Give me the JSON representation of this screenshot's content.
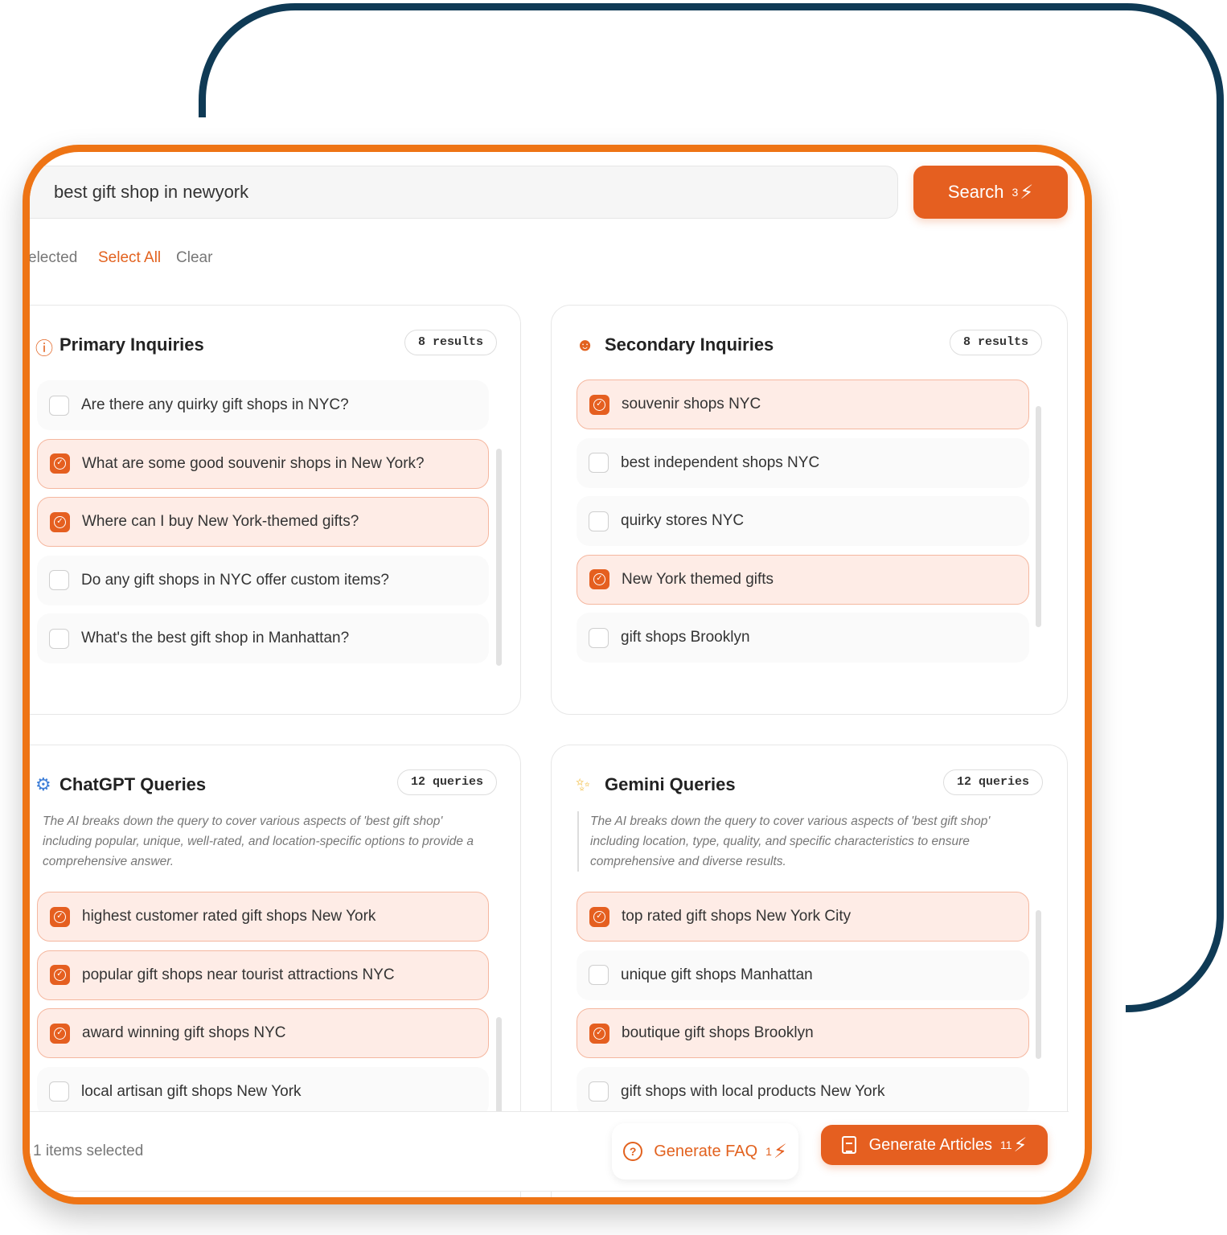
{
  "search": {
    "value": "best gift shop in newyork",
    "button_label": "Search",
    "button_cost": "3"
  },
  "selection": {
    "count_label": "elected",
    "select_all": "Select All",
    "clear": "Clear"
  },
  "primary": {
    "title": "Primary Inquiries",
    "badge": "8 results",
    "items": [
      {
        "label": "Are there any quirky gift shops in NYC?",
        "checked": false
      },
      {
        "label": "What are some good souvenir shops in New York?",
        "checked": true
      },
      {
        "label": "Where can I buy New York-themed gifts?",
        "checked": true
      },
      {
        "label": "Do any gift shops in NYC offer custom items?",
        "checked": false
      },
      {
        "label": "What's the best gift shop in Manhattan?",
        "checked": false
      }
    ]
  },
  "secondary": {
    "title": "Secondary Inquiries",
    "badge": "8 results",
    "items": [
      {
        "label": "souvenir shops NYC",
        "checked": true
      },
      {
        "label": "best independent shops NYC",
        "checked": false
      },
      {
        "label": "quirky stores NYC",
        "checked": false
      },
      {
        "label": "New York themed gifts",
        "checked": true
      },
      {
        "label": "gift shops Brooklyn",
        "checked": false
      }
    ]
  },
  "chatgpt": {
    "title": "ChatGPT Queries",
    "badge": "12 queries",
    "description": "The AI breaks down the query to cover various aspects of 'best gift shop' including popular, unique, well-rated, and location-specific options to provide a comprehensive answer.",
    "items": [
      {
        "label": "highest customer rated gift shops New York",
        "checked": true
      },
      {
        "label": "popular gift shops near tourist attractions NYC",
        "checked": true
      },
      {
        "label": "award winning gift shops NYC",
        "checked": true
      },
      {
        "label": "local artisan gift shops New York",
        "checked": false
      }
    ]
  },
  "gemini": {
    "title": "Gemini Queries",
    "badge": "12 queries",
    "description": "The AI breaks down the query to cover various aspects of 'best gift shop' including location, type, quality, and specific characteristics to ensure comprehensive and diverse results.",
    "items": [
      {
        "label": "top rated gift shops New York City",
        "checked": true
      },
      {
        "label": "unique gift shops Manhattan",
        "checked": false
      },
      {
        "label": "boutique gift shops Brooklyn",
        "checked": true
      },
      {
        "label": "gift shops with local products New York",
        "checked": false
      }
    ]
  },
  "footer": {
    "items_selected": "1 items selected",
    "faq_label": "Generate FAQ",
    "faq_cost": "1",
    "articles_label": "Generate Articles",
    "articles_cost": "11"
  },
  "colors": {
    "accent": "#e55f20",
    "frame_orange": "#ee7415",
    "deco_navy": "#0f3a55",
    "selected_bg": "#feece6"
  }
}
